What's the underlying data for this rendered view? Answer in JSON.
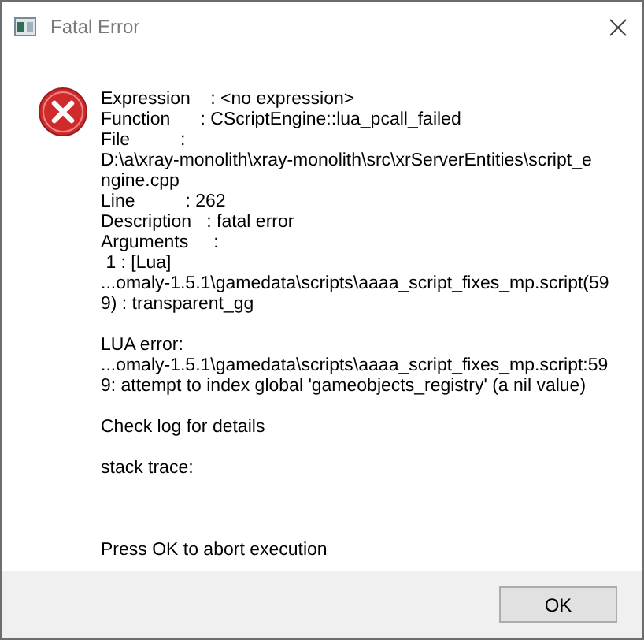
{
  "window": {
    "title": "Fatal Error"
  },
  "message": [
    {
      "kind": "text",
      "lines": [
        "Expression    : <no expression>",
        "Function      : CScriptEngine::lua_pcall_failed",
        "File          :",
        "D:\\a\\xray-monolith\\xray-monolith\\src\\xrServerEntities\\script_e",
        "ngine.cpp",
        "Line          : 262",
        "Description   : fatal error",
        "Arguments     :",
        " 1 : [Lua]",
        "...omaly-1.5.1\\gamedata\\scripts\\aaaa_script_fixes_mp.script(59",
        "9) : transparent_gg"
      ]
    },
    {
      "kind": "text",
      "lines": [
        "LUA error:",
        "...omaly-1.5.1\\gamedata\\scripts\\aaaa_script_fixes_mp.script:59",
        "9: attempt to index global 'gameobjects_registry' (a nil value)"
      ]
    },
    {
      "kind": "text",
      "lines": [
        "Check log for details"
      ]
    },
    {
      "kind": "trace",
      "lines": [
        "stack trace:"
      ]
    },
    {
      "kind": "text",
      "lines": [
        "Press OK to abort execution"
      ]
    }
  ],
  "buttons": [
    {
      "label": "OK"
    }
  ]
}
